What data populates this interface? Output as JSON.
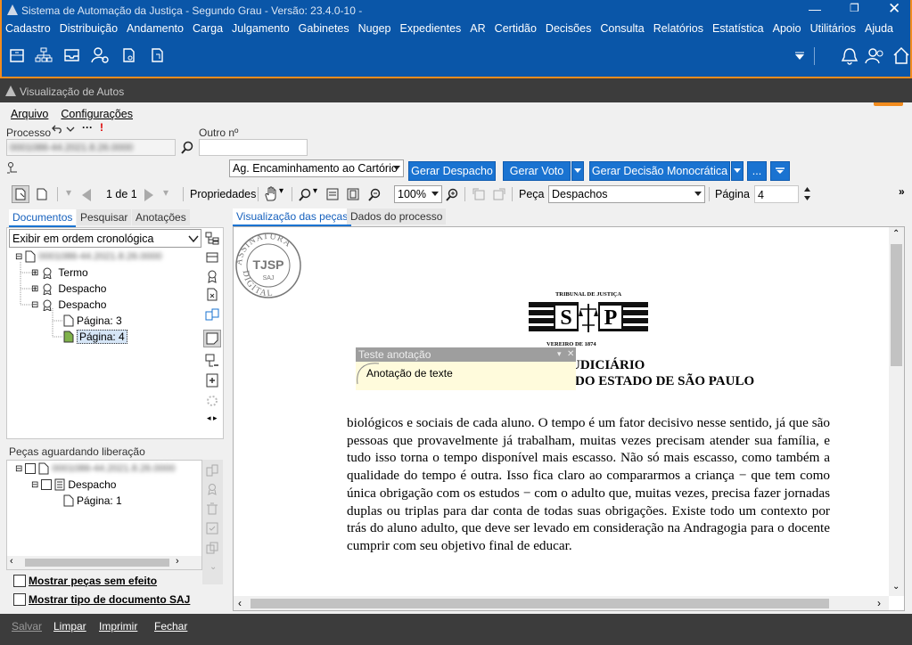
{
  "app_window": {
    "title": "Sistema de Automação da Justiça - Segundo Grau - Versão: 23.4.0-10 -",
    "menu": [
      "Cadastro",
      "Distribuição",
      "Andamento",
      "Carga",
      "Julgamento",
      "Gabinetes",
      "Nugep",
      "Expedientes",
      "AR",
      "Certidão",
      "Decisões",
      "Consulta",
      "Relatórios",
      "Estatística",
      "Apoio",
      "Utilitários",
      "Ajuda"
    ],
    "highlight_badge": "1",
    "accent_color": "#0a56a8",
    "highlight_color": "#f28c1e"
  },
  "viewer_window": {
    "title": "Visualização de Autos",
    "menu": [
      "Arquivo",
      "Configurações"
    ],
    "processo_label": "Processo",
    "processo_value": "0001086-44.2021.8.26.0000",
    "outro_label": "Outro nº",
    "outro_value": "",
    "status_value": "Ag. Encaminhamento ao Cartório",
    "buttons": {
      "gerar_despacho": "Gerar Despacho",
      "gerar_voto": "Gerar Voto",
      "gerar_decisao": "Gerar Decisão Monocrática",
      "more": "..."
    },
    "toolbar": {
      "page_indicator": "1 de 1",
      "properties": "Propriedades",
      "zoom": "100%",
      "peca_label": "Peça",
      "peca_value": "Despachos",
      "pagina_label": "Página",
      "pagina_value": "4"
    }
  },
  "left_panel": {
    "tabs": [
      "Documentos",
      "Pesquisar",
      "Anotações"
    ],
    "order_select": "Exibir em ordem cronológica",
    "tree": {
      "root": "0001086-44.2021.8.26.0000",
      "items": [
        "Termo",
        "Despacho",
        "Despacho"
      ],
      "pages": [
        "Página: 3",
        "Página: 4"
      ]
    },
    "pending_header": "Peças aguardando liberação",
    "pending_tree": {
      "root": "0001086-44.2021.8.26.0000",
      "item": "Despacho",
      "page": "Página: 1"
    },
    "checkboxes": [
      "Mostrar peças sem efeito",
      "Mostrar tipo de documento SAJ"
    ]
  },
  "doc_panel": {
    "tabs": [
      "Visualização das peças",
      "Dados do processo"
    ],
    "stamp_top": "ASSINATURA",
    "stamp_center": "TJSP",
    "stamp_sub": "SAJ",
    "stamp_bottom": "DIGITAL",
    "logo_top": "TRIBUNAL DE JUSTIÇA",
    "logo_letters": [
      "S",
      "P"
    ],
    "logo_bottom": "VEREIRO DE 1874",
    "heading1": "UDICIÁRIO",
    "heading2": "DO ESTADO DE SÃO PAULO",
    "annotation_header": "Teste anotação",
    "annotation_text": "Anotação de texte",
    "body_text": "biológicos e sociais de cada aluno. O tempo é um fator decisivo nesse sentido, já que são pessoas que provavelmente já trabalham, muitas vezes precisam atender sua família, e tudo isso torna o tempo disponível mais escasso. Não só mais escasso, como também a qualidade do tempo é outra. Isso fica claro ao compararmos a criança − que tem como única obrigação com os estudos − com o adulto que, muitas vezes, precisa fazer jornadas duplas ou triplas para dar conta de todas suas obrigações. Existe todo um contexto por trás do aluno adulto, que deve ser levado em consideração na Andragogia para o docente cumprir com seu objetivo final de educar."
  },
  "footer": {
    "buttons": [
      "Salvar",
      "Limpar",
      "Imprimir",
      "Fechar"
    ]
  }
}
